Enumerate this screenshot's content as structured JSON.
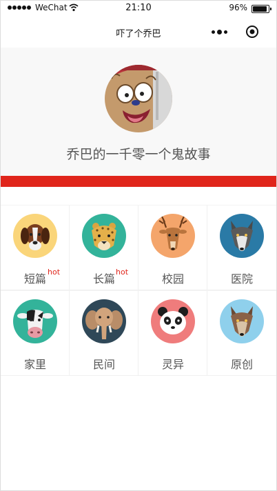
{
  "status_bar": {
    "carrier": "WeChat",
    "time": "21:10",
    "battery": "96%"
  },
  "nav": {
    "title": "吓了个乔巴"
  },
  "hero": {
    "title": "乔巴的一千零一个鬼故事"
  },
  "categories": [
    {
      "label": "短篇",
      "hot": "hot",
      "icon": "dog-icon",
      "bg": "#fad57a"
    },
    {
      "label": "长篇",
      "hot": "hot",
      "icon": "leopard-icon",
      "bg": "#33b39a"
    },
    {
      "label": "校园",
      "hot": "",
      "icon": "deer-icon",
      "bg": "#f4a56b"
    },
    {
      "label": "医院",
      "hot": "",
      "icon": "wolf-icon",
      "bg": "#2a7aa6"
    },
    {
      "label": "家里",
      "hot": "",
      "icon": "cow-icon",
      "bg": "#33b39a"
    },
    {
      "label": "民间",
      "hot": "",
      "icon": "elephant-icon",
      "bg": "#2f4858"
    },
    {
      "label": "灵异",
      "hot": "",
      "icon": "panda-icon",
      "bg": "#ef7c7c"
    },
    {
      "label": "原创",
      "hot": "",
      "icon": "wolf-icon",
      "bg": "#8fd0ec"
    }
  ],
  "colors": {
    "accent": "#e0251b",
    "hero_bg": "#f8f8f8"
  }
}
